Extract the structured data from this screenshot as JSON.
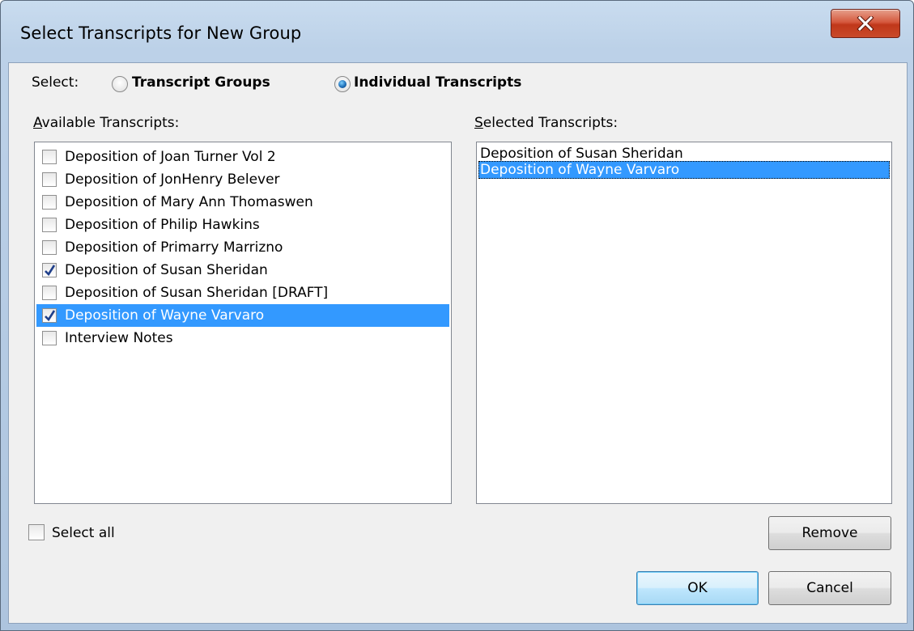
{
  "window": {
    "title": "Select Transcripts for New Group"
  },
  "select_row": {
    "label": "Select:",
    "options": [
      {
        "label": "Transcript Groups",
        "checked": false
      },
      {
        "label": "Individual Transcripts",
        "checked": true
      }
    ]
  },
  "available": {
    "label_accel": "A",
    "label_rest": "vailable Transcripts:",
    "items": [
      {
        "label": "Deposition of Joan Turner Vol 2",
        "checked": false,
        "selected": false
      },
      {
        "label": "Deposition of JonHenry Belever",
        "checked": false,
        "selected": false
      },
      {
        "label": "Deposition of Mary Ann Thomaswen",
        "checked": false,
        "selected": false
      },
      {
        "label": "Deposition of Philip Hawkins",
        "checked": false,
        "selected": false
      },
      {
        "label": "Deposition of Primarry Marrizno",
        "checked": false,
        "selected": false
      },
      {
        "label": "Deposition of Susan Sheridan",
        "checked": true,
        "selected": false
      },
      {
        "label": "Deposition of Susan Sheridan [DRAFT]",
        "checked": false,
        "selected": false
      },
      {
        "label": "Deposition of Wayne Varvaro",
        "checked": true,
        "selected": true
      },
      {
        "label": "Interview Notes",
        "checked": false,
        "selected": false
      }
    ]
  },
  "selected": {
    "label_accel": "S",
    "label_rest": "elected Transcripts:",
    "items": [
      {
        "label": "Deposition of Susan Sheridan",
        "selected": false
      },
      {
        "label": "Deposition of Wayne Varvaro",
        "selected": true
      }
    ]
  },
  "select_all": {
    "label": "Select all",
    "checked": false
  },
  "buttons": {
    "remove": "Remove",
    "ok": "OK",
    "cancel": "Cancel"
  },
  "colors": {
    "selection": "#3399ff",
    "close_button": "#c9432a",
    "frame": "#bcd1e8"
  }
}
